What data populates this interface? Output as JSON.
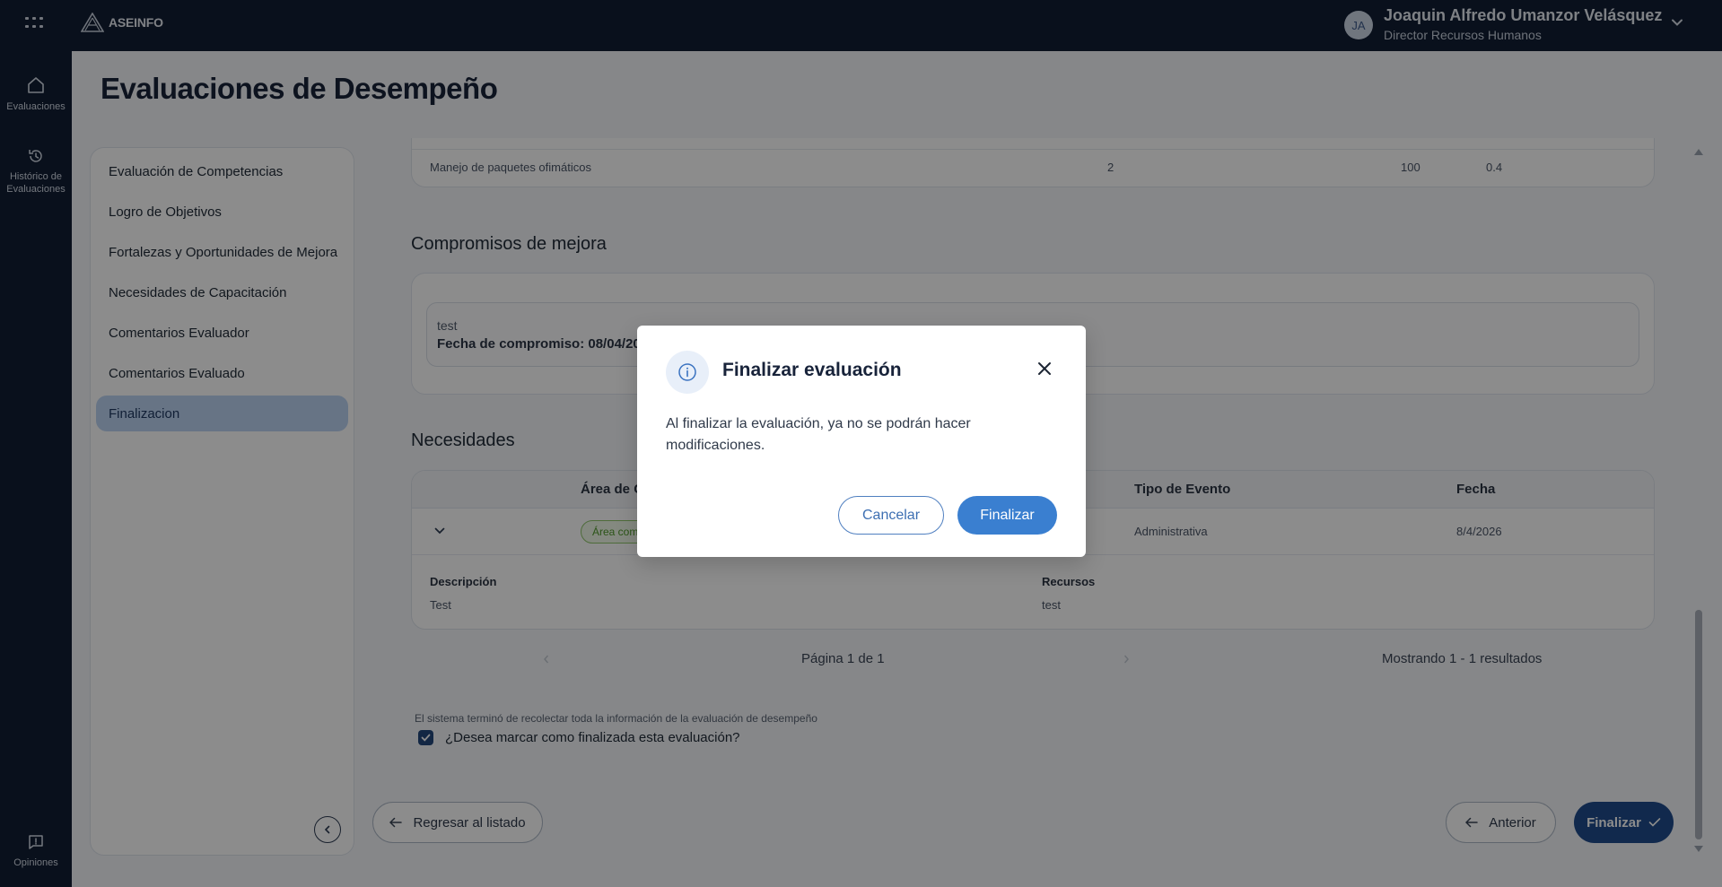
{
  "header": {
    "brand": "ASEINFO",
    "user": {
      "initials": "JA",
      "name": "Joaquin Alfredo Umanzor Velásquez",
      "role": "Director Recursos Humanos"
    }
  },
  "rail": {
    "evaluaciones": "Evaluaciones",
    "historico_line1": "Histórico de",
    "historico_line2": "Evaluaciones",
    "opiniones": "Opiniones"
  },
  "page": {
    "title": "Evaluaciones de Desempeño"
  },
  "sidebar": {
    "items": [
      {
        "label": "Evaluación de Competencias"
      },
      {
        "label": "Logro de Objetivos"
      },
      {
        "label": "Fortalezas y Oportunidades de Mejora"
      },
      {
        "label": "Necesidades de Capacitación"
      },
      {
        "label": "Comentarios Evaluador"
      },
      {
        "label": "Comentarios Evaluado"
      },
      {
        "label": "Finalizacion"
      }
    ],
    "active_index": 6
  },
  "competencias_table": {
    "row": {
      "name": "Manejo de paquetes ofimáticos",
      "value": "2",
      "percent": "100",
      "score": "0.4"
    }
  },
  "compromisos": {
    "title": "Compromisos de mejora",
    "text": "test",
    "date": "Fecha de compromiso: 08/04/20"
  },
  "necesidades": {
    "title": "Necesidades",
    "headers": {
      "area": "Área de C",
      "tipo": "Tipo de Evento",
      "fecha": "Fecha"
    },
    "row": {
      "area_tag": "Área com",
      "tipo": "Administrativa",
      "fecha": "8/4/2026"
    },
    "detail": {
      "descripcion_label": "Descripción",
      "descripcion_value": "Test",
      "recursos_label": "Recursos",
      "recursos_value": "test"
    },
    "pagination": {
      "page_text": "Página 1 de 1",
      "results_text": "Mostrando 1 - 1 resultados"
    }
  },
  "finalizacion": {
    "system_note": "El sistema terminó de recolectar toda la información de la evaluación de desempeño",
    "checkbox_label": "¿Desea marcar como finalizada esta evaluación?",
    "checked": true
  },
  "footer_buttons": {
    "back": "Regresar al listado",
    "prev": "Anterior",
    "finish": "Finalizar"
  },
  "modal": {
    "title": "Finalizar evaluación",
    "body": "Al finalizar la evaluación, ya no se podrán hacer modificaciones.",
    "cancel": "Cancelar",
    "confirm": "Finalizar"
  },
  "colors": {
    "topbar": "#111e34",
    "active_nav": "#bcd3f2",
    "primary": "#1f4b8c",
    "modal_primary": "#3a7fd0",
    "tag_green": "#4f9a2a"
  },
  "icons": {
    "apps": "apps-grid-icon",
    "home": "home-icon",
    "history": "history-icon",
    "feedback": "feedback-icon",
    "info": "info-icon",
    "close": "close-icon"
  }
}
